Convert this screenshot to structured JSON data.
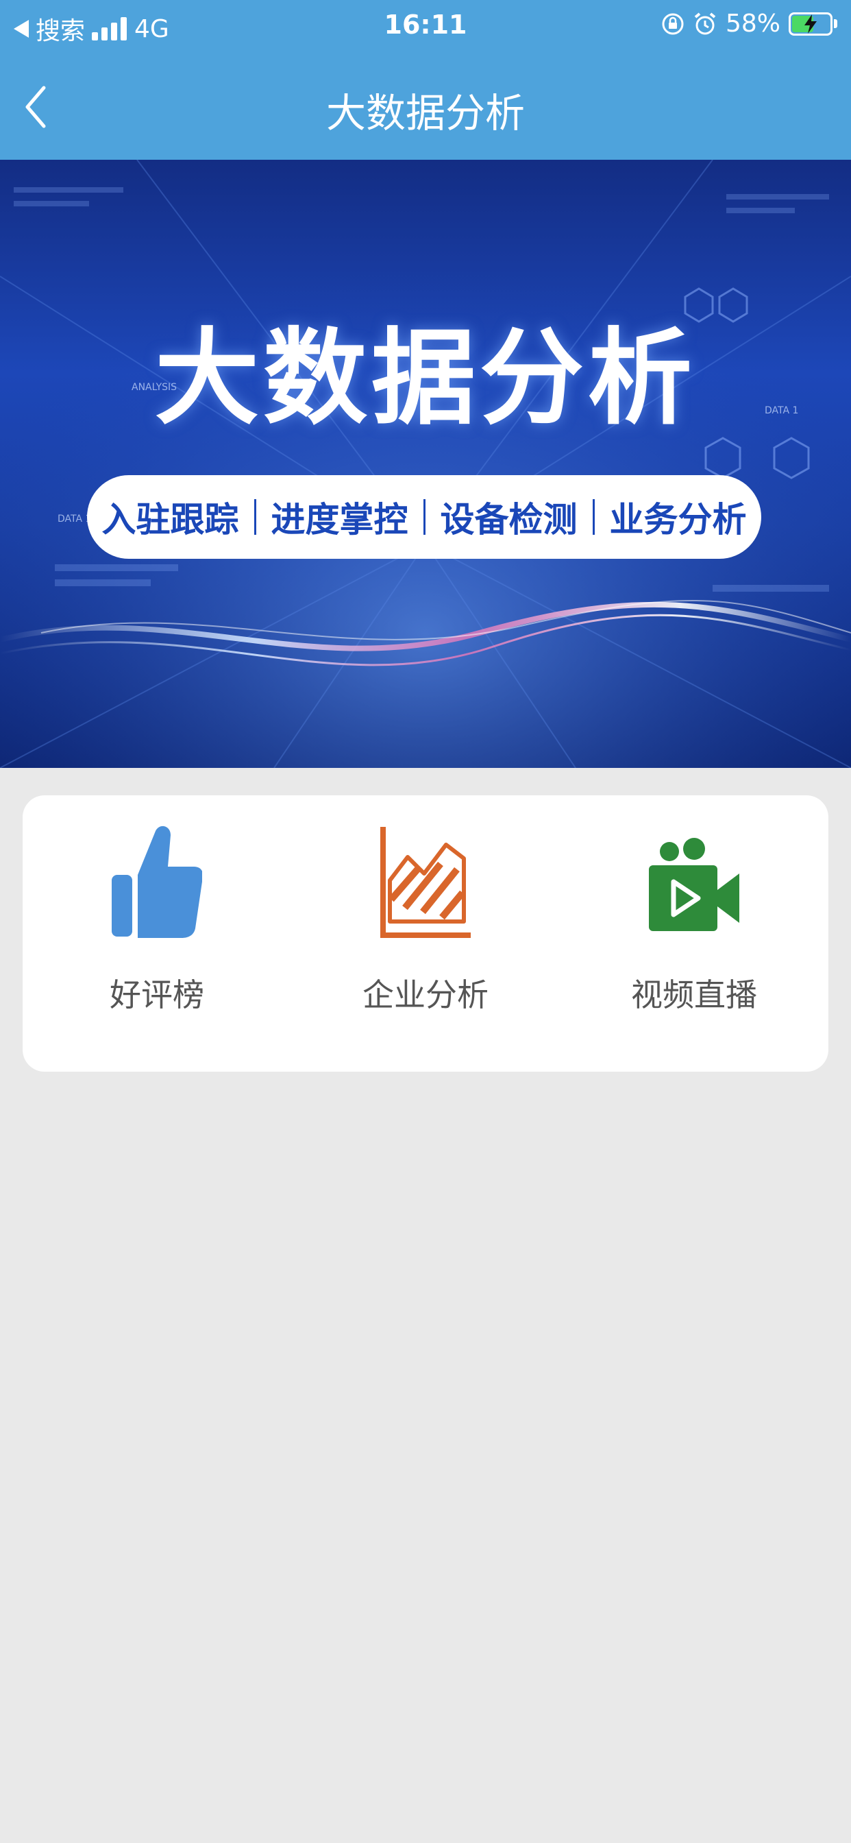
{
  "status_bar": {
    "carrier_back": "搜索",
    "network": "4G",
    "time": "16:11",
    "battery_percent": "58%",
    "battery_level": 0.58,
    "icons": [
      "back-arrow-icon",
      "signal-icon",
      "orientation-lock-icon",
      "alarm-icon",
      "battery-charging-icon"
    ]
  },
  "navbar": {
    "title": "大数据分析",
    "back_icon": "chevron-left-icon"
  },
  "banner": {
    "title": "大数据分析",
    "tags": [
      "入驻跟踪",
      "进度掌控",
      "设备检测",
      "业务分析"
    ],
    "deco_labels": [
      "ANALYSIS",
      "DATA 1",
      "DATA 1"
    ]
  },
  "tiles": [
    {
      "label": "好评榜",
      "icon": "thumbs-up-icon",
      "color": "#4a90d9"
    },
    {
      "label": "企业分析",
      "icon": "area-chart-icon",
      "color": "#d9662b"
    },
    {
      "label": "视频直播",
      "icon": "video-camera-icon",
      "color": "#2e8b3a"
    }
  ],
  "colors": {
    "header": "#4ea3dc",
    "page_bg": "#e9e9e9",
    "banner_blue": "#1d47b8"
  }
}
